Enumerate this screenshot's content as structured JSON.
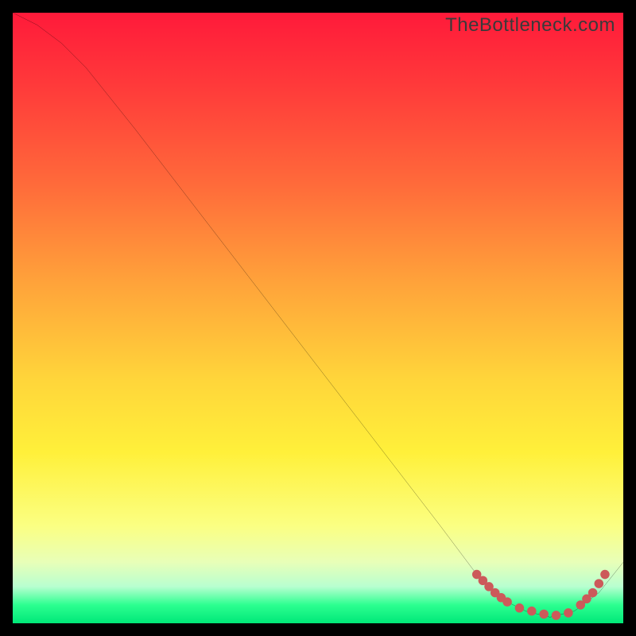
{
  "watermark": "TheBottleneck.com",
  "chart_data": {
    "type": "line",
    "title": "",
    "xlabel": "",
    "ylabel": "",
    "xlim": [
      0,
      100
    ],
    "ylim": [
      0,
      100
    ],
    "series": [
      {
        "name": "curve",
        "x": [
          0,
          4,
          8,
          12,
          20,
          30,
          40,
          50,
          60,
          70,
          76,
          80,
          84,
          88,
          92,
          96,
          100
        ],
        "y": [
          100,
          98,
          95,
          91,
          81,
          68,
          55,
          42,
          29,
          16,
          8,
          4,
          2,
          1,
          2,
          5,
          10
        ]
      }
    ],
    "markers": {
      "name": "dots",
      "x": [
        76,
        77,
        78,
        79,
        80,
        81,
        83,
        85,
        87,
        89,
        91,
        93,
        94,
        95,
        96,
        97
      ],
      "y": [
        8,
        7,
        6,
        5,
        4.2,
        3.5,
        2.5,
        2,
        1.5,
        1.3,
        1.7,
        3,
        4,
        5,
        6.5,
        8
      ]
    },
    "colors": {
      "line": "#000000",
      "marker": "#cc5a5a"
    }
  }
}
